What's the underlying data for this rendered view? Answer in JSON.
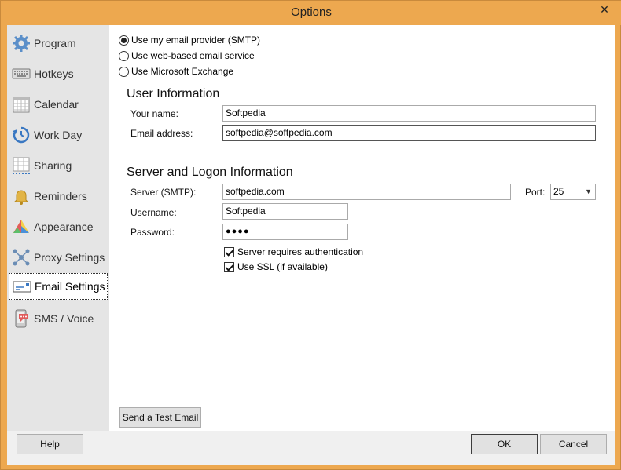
{
  "window": {
    "title": "Options",
    "close_glyph": "✕"
  },
  "sidebar": {
    "items": [
      {
        "label": "Program",
        "icon": "gear-icon"
      },
      {
        "label": "Hotkeys",
        "icon": "keyboard-icon"
      },
      {
        "label": "Calendar",
        "icon": "calendar-icon"
      },
      {
        "label": "Work Day",
        "icon": "clock-arrow-icon"
      },
      {
        "label": "Sharing",
        "icon": "sharing-icon"
      },
      {
        "label": "Reminders",
        "icon": "bell-icon"
      },
      {
        "label": "Appearance",
        "icon": "palette-icon"
      },
      {
        "label": "Proxy Settings",
        "icon": "network-icon"
      },
      {
        "label": "Email Settings",
        "icon": "email-icon"
      },
      {
        "label": "SMS / Voice",
        "icon": "phone-icon"
      }
    ],
    "selected": "Email Settings"
  },
  "provider": {
    "options": [
      {
        "label": "Use my email provider (SMTP)",
        "checked": true
      },
      {
        "label": "Use web-based email service",
        "checked": false
      },
      {
        "label": "Use Microsoft Exchange",
        "checked": false
      }
    ]
  },
  "user_info": {
    "title": "User Information",
    "name_label": "Your name:",
    "name_value": "Softpedia",
    "email_label": "Email address:",
    "email_value": "softpedia@softpedia.com"
  },
  "server_info": {
    "title": "Server and Logon Information",
    "server_label": "Server (SMTP):",
    "server_value": "softpedia.com",
    "port_label": "Port:",
    "port_value": "25",
    "username_label": "Username:",
    "username_value": "Softpedia",
    "password_label": "Password:",
    "password_value": "●●●●",
    "auth_label": "Server requires authentication",
    "auth_checked": true,
    "ssl_label": "Use SSL (if available)",
    "ssl_checked": true
  },
  "buttons": {
    "test_email": "Send a Test Email",
    "help": "Help",
    "ok": "OK",
    "cancel": "Cancel"
  }
}
